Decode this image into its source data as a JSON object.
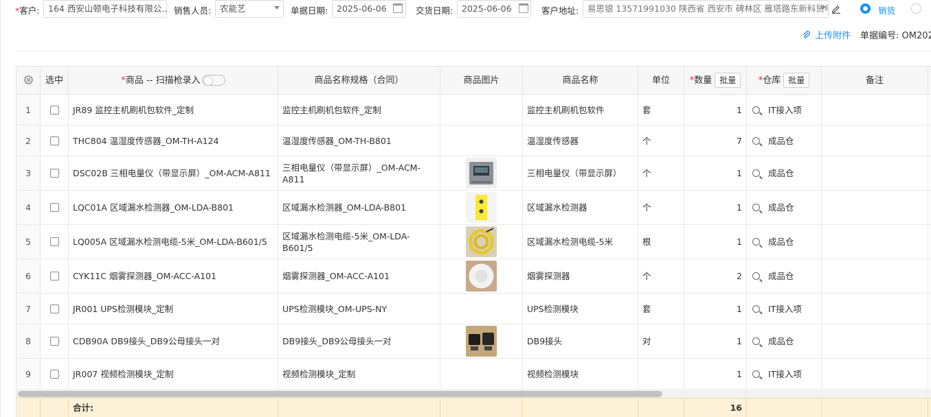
{
  "form": {
    "customer_label": "客户:",
    "customer_value": "164 西安山顿电子科技有限公...",
    "sales_label": "销售人员:",
    "sales_value": "农能艺",
    "doc_date_label": "单据日期:",
    "doc_date_value": "2025-06-06",
    "delivery_date_label": "交货日期:",
    "delivery_date_value": "2025-06-06",
    "address_label": "客户地址:",
    "address_value": "易思银 13571991030 陕西省 西安市 碑林区 雁塔路东新科贸电",
    "type_sale": "销货",
    "upload_label": "上传附件",
    "docno_label": "单据编号:",
    "docno_value": "OM202"
  },
  "table": {
    "headers": {
      "select": "选中",
      "product": "商品 -- 扫描枪录入",
      "spec": "商品名称规格（合同）",
      "image": "商品图片",
      "name": "商品名称",
      "unit": "单位",
      "qty": "数量",
      "warehouse": "仓库",
      "remark": "备注",
      "batch": "批量"
    },
    "rows": [
      {
        "no": "1",
        "product": "JR89 监控主机刷机包软件_定制",
        "spec": "监控主机刷机包软件_定制",
        "name": "监控主机刷机包软件",
        "unit": "套",
        "qty": "1",
        "warehouse": "IT接入项",
        "img": ""
      },
      {
        "no": "2",
        "product": "THC804 温湿度传感器_OM-TH-A124",
        "spec": "温湿度传感器_OM-TH-B801",
        "name": "温湿度传感器",
        "unit": "个",
        "qty": "7",
        "warehouse": "成品仓",
        "img": ""
      },
      {
        "no": "3",
        "product": "DSC02B 三相电量仪（带显示屏）_OM-ACM-A811",
        "spec": "三相电量仪（带显示屏）_OM-ACM-A811",
        "name": "三相电量仪（带显示屏）",
        "unit": "个",
        "qty": "1",
        "warehouse": "成品仓",
        "img": "meter"
      },
      {
        "no": "4",
        "product": "LQC01A 区域漏水检测器_OM-LDA-B801",
        "spec": "区域漏水检测器_OM-LDA-B801",
        "name": "区域漏水检测器",
        "unit": "个",
        "qty": "1",
        "warehouse": "成品仓",
        "img": "leak"
      },
      {
        "no": "5",
        "product": "LQ005A 区域漏水检测电缆-5米_OM-LDA-B601/5",
        "spec": "区域漏水检测电缆-5米_OM-LDA-B601/5",
        "name": "区域漏水检测电缆-5米",
        "unit": "根",
        "qty": "1",
        "warehouse": "成品仓",
        "img": "cable"
      },
      {
        "no": "6",
        "product": "CYK11C 烟雾探测器_OM-ACC-A101",
        "spec": "烟雾探测器_OM-ACC-A101",
        "name": "烟雾探测器",
        "unit": "个",
        "qty": "2",
        "warehouse": "成品仓",
        "img": "smoke"
      },
      {
        "no": "7",
        "product": "JR001 UPS检测模块_定制",
        "spec": "UPS检测模块_OM-UPS-NY",
        "name": "UPS检测模块",
        "unit": "套",
        "qty": "1",
        "warehouse": "IT接入项",
        "img": ""
      },
      {
        "no": "8",
        "product": "CDB90A DB9接头_DB9公母接头一对",
        "spec": "DB9接头_DB9公母接头一对",
        "name": "DB9接头",
        "unit": "对",
        "qty": "1",
        "warehouse": "成品仓",
        "img": "db9"
      },
      {
        "no": "9",
        "product": "JR007 视频检测模块_定制",
        "spec": "视频检测模块_定制",
        "name": "视频检测模块",
        "unit": "",
        "qty": "1",
        "warehouse": "IT接入项",
        "img": ""
      }
    ],
    "summary": {
      "label": "合计:",
      "qty_total": "16"
    }
  },
  "icons": [
    "settings-icon",
    "search-icon",
    "calendar-icon",
    "paperclip-icon",
    "edit-icon"
  ],
  "colors": {
    "accent": "#1890ff",
    "required": "#f5222d",
    "summary_bg": "#fdf2d8"
  }
}
